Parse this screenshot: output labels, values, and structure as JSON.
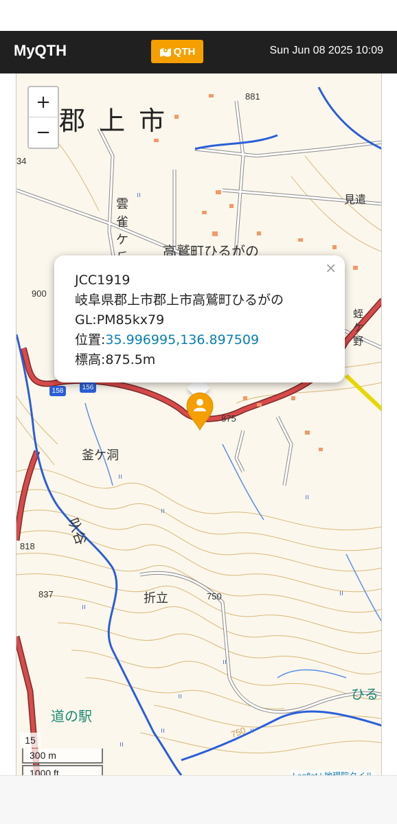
{
  "header": {
    "brand": "MyQTH",
    "qth_button_label": "QTH",
    "datetime": "Sun Jun 08 2025 10:09"
  },
  "zoom_controls": {
    "zoom_in": "+",
    "zoom_out": "−"
  },
  "popup": {
    "code": "JCC1919",
    "address": "岐阜県郡上市郡上市高鷲町ひるがの",
    "grid": "GL:PM85kx79",
    "position_label": "位置:",
    "coordinates": "35.996995,136.897509",
    "elevation": "標高:875.5m",
    "close_label": "×"
  },
  "map_labels": {
    "city": "郡 上 市",
    "town": "高鷲町ひるがの",
    "hamlet_1": "雲\n雀\nケ\n丘",
    "hamlet_2": "釜ケ洞",
    "hamlet_3": "叺谷",
    "hamlet_4": "折立",
    "hamlet_5": "見遣",
    "hamlet_6": "蛭ケ野",
    "station": "道の駅",
    "place_right": "ひる",
    "elev_881": "881",
    "elev_900": "900",
    "elev_875": "875",
    "elev_818": "818",
    "elev_837": "837",
    "elev_750": "750",
    "elev_750b": "750",
    "elev_34": "34",
    "route_158": "158",
    "route_156": "156"
  },
  "scale": {
    "zoom_level": "15",
    "metric": "300 m",
    "imperial": "1000 ft"
  },
  "attribution": "Leaflet | 地理院タイル",
  "colors": {
    "header_bg": "#202020",
    "accent": "#f5a000",
    "link": "#0a7fb0",
    "road": "#c83a3a",
    "river": "#2a5fd8"
  }
}
